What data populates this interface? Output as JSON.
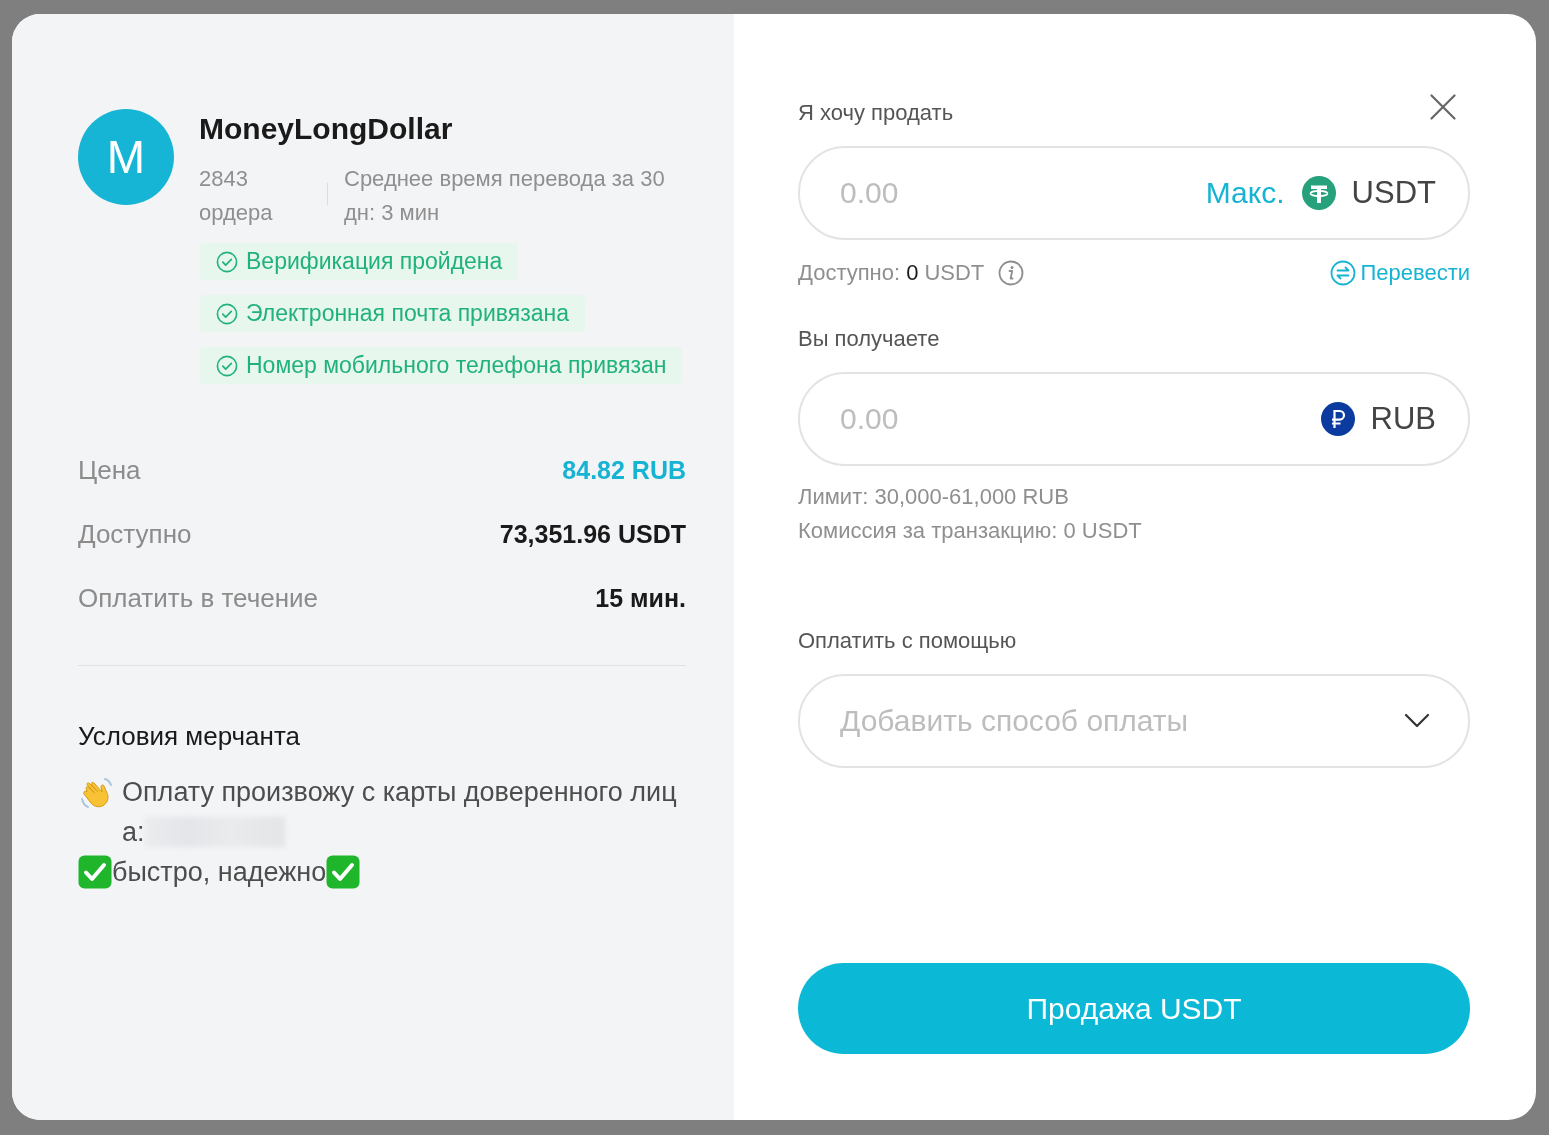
{
  "merchant": {
    "avatar_letter": "M",
    "name": "MoneyLongDollar",
    "orders": "2843 ордера",
    "avg_transfer_time": "Среднее время перевода за 30 дн: 3 мин",
    "badges": [
      "Верификация пройдена",
      "Электронная почта привязана",
      "Номер мобильного телефона привязан"
    ]
  },
  "details": [
    {
      "kind": "price",
      "label": "Цена",
      "value": "84.82 RUB"
    },
    {
      "kind": "amount",
      "label": "Доступно",
      "value": "73,351.96 USDT"
    },
    {
      "kind": "amount",
      "label": "Оплатить в течение",
      "value": "15 мин."
    }
  ],
  "terms": {
    "title": "Условия мерчанта",
    "lines": [
      {
        "kind": "wave",
        "text": "Оплату произвожу с карты доверенного лица:",
        "redacted": true
      },
      {
        "kind": "check",
        "text": "быстро, надежно",
        "redacted": false
      }
    ]
  },
  "sell": {
    "label": "Я хочу продать",
    "placeholder": "0.00",
    "max": "Макс.",
    "currency": "USDT",
    "available": {
      "label": "Доступно:",
      "amount": "0",
      "currency": "USDT"
    },
    "transfer": "Перевести"
  },
  "receive": {
    "label": "Вы получаете",
    "placeholder": "0.00",
    "currency": "RUB",
    "limit": "Лимит: 30,000-61,000 RUB",
    "fee": "Комиссия за транзакцию: 0 USDT"
  },
  "payment": {
    "label": "Оплатить с помощью",
    "placeholder": "Добавить способ оплаты"
  },
  "submit": "Продажа USDT"
}
